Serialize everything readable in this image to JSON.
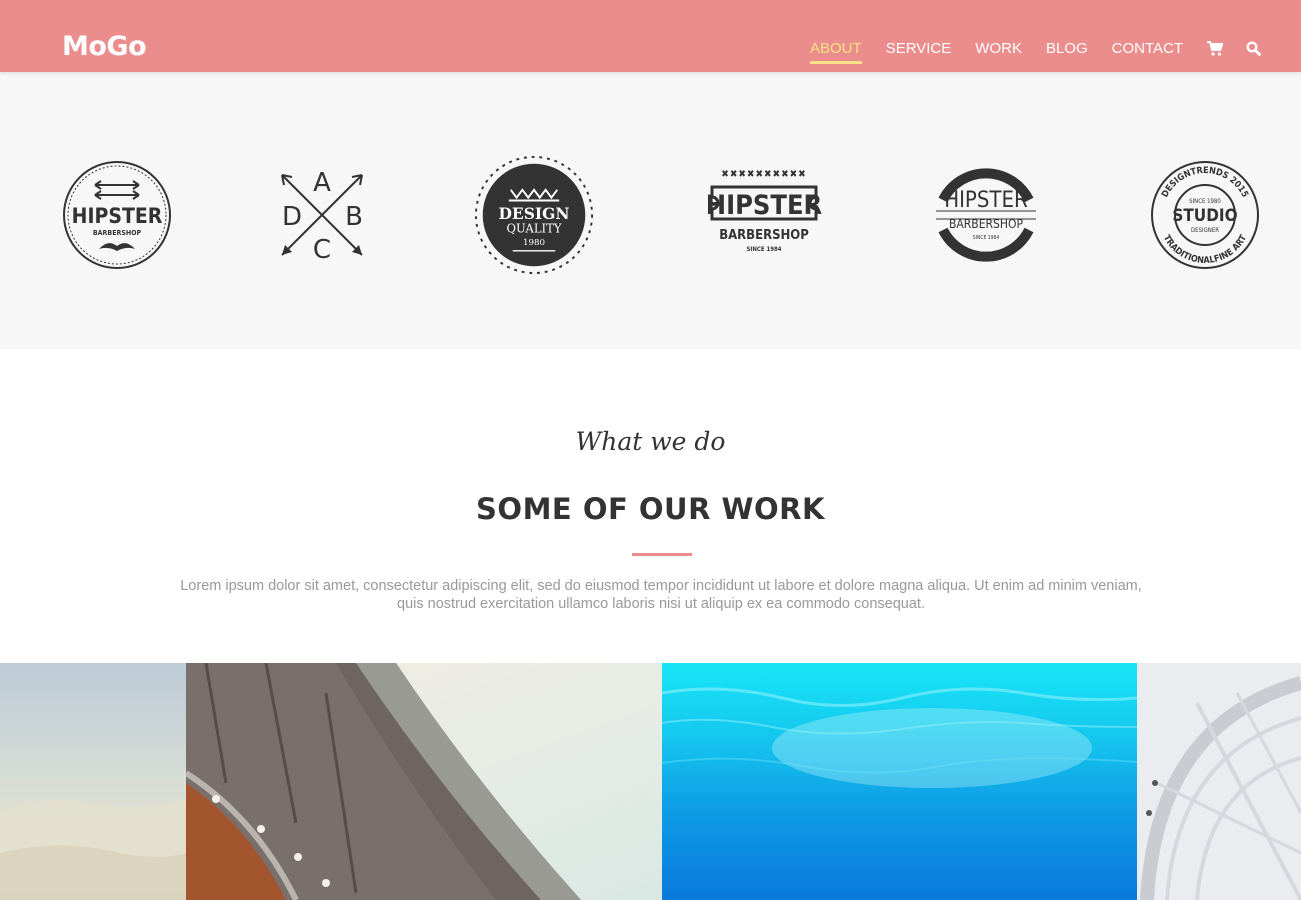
{
  "header": {
    "logo": "MoGo",
    "nav": [
      {
        "label": "ABOUT",
        "active": true
      },
      {
        "label": "SERVICE",
        "active": false
      },
      {
        "label": "WORK",
        "active": false
      },
      {
        "label": "BLOG",
        "active": false
      },
      {
        "label": "CONTACT",
        "active": false
      }
    ],
    "icons": [
      "cart-icon",
      "search-icon"
    ],
    "colors": {
      "background": "#ec8d8d",
      "text": "#ffffff",
      "active": "#f8e186"
    }
  },
  "logos": [
    {
      "name": "hipster-barbershop-mustache-logo",
      "lines": [
        "HIPSTER",
        "BARBERSHOP"
      ]
    },
    {
      "name": "abcd-arrows-logo",
      "lines": [
        "A",
        "B",
        "C",
        "D"
      ]
    },
    {
      "name": "design-quality-logo",
      "lines": [
        "DESIGN",
        "QUALITY",
        "1980"
      ]
    },
    {
      "name": "hipster-barbershop-plaque-logo",
      "lines": [
        "HIPSTER",
        "BARBERSHOP",
        "SINCE 1984"
      ]
    },
    {
      "name": "hipster-barbershop-circle-logo",
      "lines": [
        "HIPSTER",
        "BARBERSHOP",
        "SINCE 1984"
      ]
    },
    {
      "name": "studio-designer-logo",
      "lines": [
        "DESIGNTRENDS 2015",
        "SINCE 1980",
        "STUDIO",
        "DESIGNER",
        "TRADITIONALFINE ART"
      ]
    }
  ],
  "work": {
    "script_title": "What we do",
    "title": "SOME OF OUR WORK",
    "lead": "Lorem ipsum dolor sit amet, consectetur adipiscing elit, sed do eiusmod tempor incididunt ut labore et dolore magna aliqua. Ut enim ad minim veniam, quis nostrud exercitation ullamco laboris nisi ut aliquip ex ea commodo consequat.",
    "accent": "#ec8d8d"
  },
  "gallery": [
    {
      "name": "sky-photo"
    },
    {
      "name": "architecture-curve-photo"
    },
    {
      "name": "underwater-photo"
    },
    {
      "name": "glass-dome-photo"
    }
  ]
}
